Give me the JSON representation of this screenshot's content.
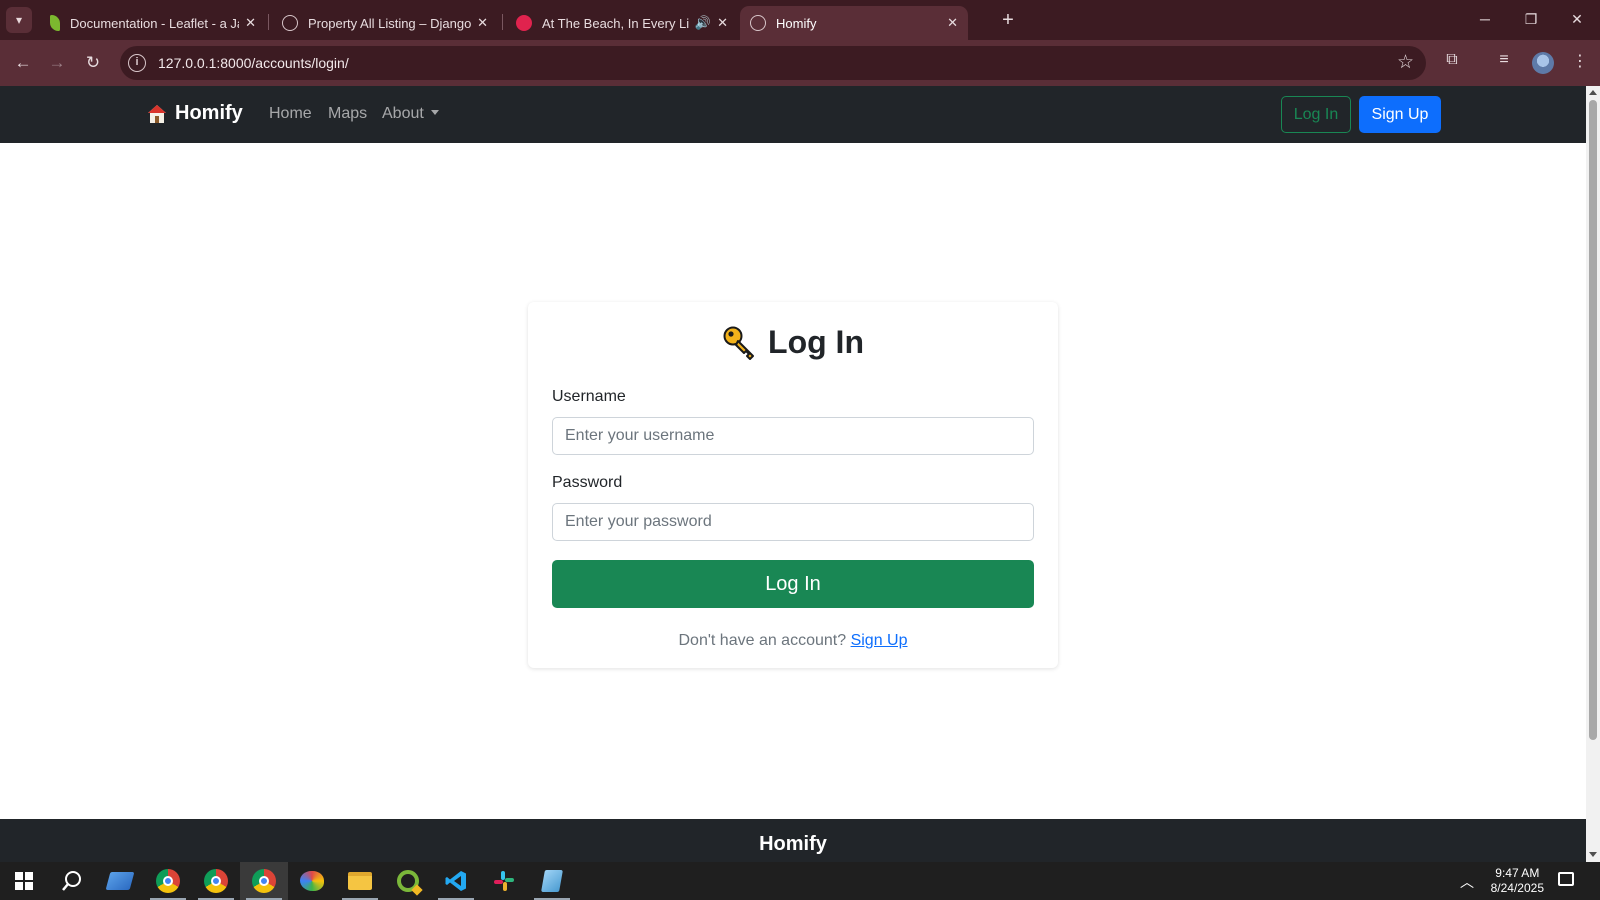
{
  "browser": {
    "tabs": [
      {
        "title": "Documentation - Leaflet - a JavaScript library",
        "icon": "leaflet-leaf-icon",
        "color": "#7cb82f"
      },
      {
        "title": "Property All Listing – Django REST",
        "icon": "globe-icon"
      },
      {
        "title": "At The Beach, In Every Life",
        "icon": "music-icon",
        "color": "#e0234e"
      },
      {
        "title": "Homify",
        "icon": "globe-icon",
        "active": true
      }
    ],
    "url": "127.0.0.1:8000/accounts/login/"
  },
  "navbar": {
    "brand": "Homify",
    "links": [
      "Home",
      "Maps",
      "About"
    ],
    "login": "Log In",
    "signup": "Sign Up"
  },
  "login_card": {
    "title": "Log In",
    "username_label": "Username",
    "username_placeholder": "Enter your username",
    "password_label": "Password",
    "password_placeholder": "Enter your password",
    "submit": "Log In",
    "no_account_text": "Don't have an account?",
    "signup_link": "Sign Up"
  },
  "footer": {
    "title": "Homify"
  },
  "taskbar": {
    "apps": [
      "windows-start",
      "search",
      "file-manager",
      "chrome",
      "chrome",
      "chrome",
      "paint",
      "file-explorer",
      "qgis",
      "vscode",
      "slack",
      "notepad"
    ],
    "time": "9:47 AM",
    "date": "8/24/2025"
  },
  "colors": {
    "success": "#198754",
    "primary": "#0d6efd",
    "navbar_bg": "#212529",
    "browser_frame": "#3c1b22",
    "browser_toolbar": "#5a2e37"
  }
}
